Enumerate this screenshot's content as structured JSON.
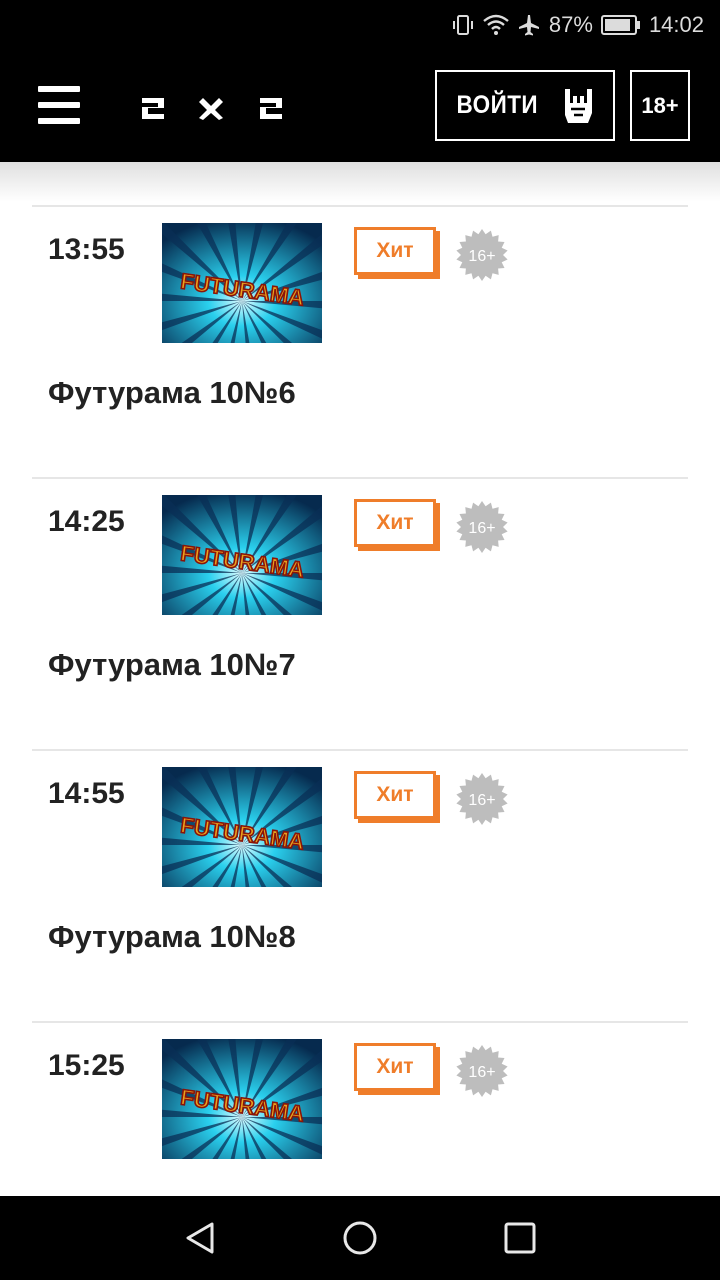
{
  "status_bar": {
    "battery": "87%",
    "time": "14:02"
  },
  "header": {
    "logo": "2 x 2",
    "login_label": "ВОЙТИ",
    "age_label": "18+"
  },
  "schedule": [
    {
      "time": "13:55",
      "badge": "Хит",
      "age": "16+",
      "title": "Футурама 10№6",
      "thumb_text": "FUTURAMA"
    },
    {
      "time": "14:25",
      "badge": "Хит",
      "age": "16+",
      "title": "Футурама 10№7",
      "thumb_text": "FUTURAMA"
    },
    {
      "time": "14:55",
      "badge": "Хит",
      "age": "16+",
      "title": "Футурама 10№8",
      "thumb_text": "FUTURAMA"
    },
    {
      "time": "15:25",
      "badge": "Хит",
      "age": "16+",
      "title": "",
      "thumb_text": "FUTURAMA"
    }
  ],
  "colors": {
    "accent": "#ef7d2a",
    "header_bg": "#000000",
    "age_badge": "#bdbdbd"
  },
  "icons": {
    "menu": "hamburger-icon",
    "login": "rock-hand-icon",
    "nav_back": "triangle-back-icon",
    "nav_home": "circle-home-icon",
    "nav_recent": "square-recent-icon"
  }
}
